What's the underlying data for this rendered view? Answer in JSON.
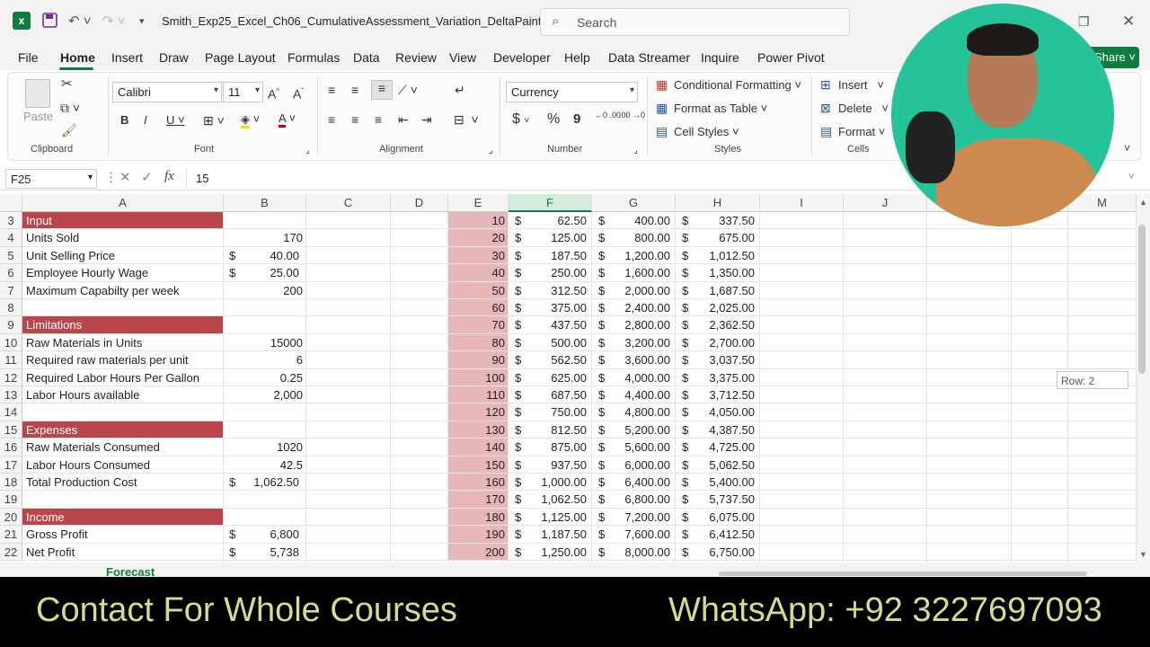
{
  "window": {
    "title": "Smith_Exp25_Excel_Ch06_CumulativeAssessment_Variation_DeltaPaint  -",
    "search_placeholder": "Search"
  },
  "menu": [
    "File",
    "Home",
    "Insert",
    "Draw",
    "Page Layout",
    "Formulas",
    "Data",
    "Review",
    "View",
    "Developer",
    "Help",
    "Data Streamer",
    "Inquire",
    "Power Pivot"
  ],
  "share_label": "Share",
  "ribbon": {
    "clipboard": {
      "paste": "Paste",
      "group": "Clipboard"
    },
    "font": {
      "name": "Calibri",
      "size": "11",
      "bold": "B",
      "italic": "I",
      "underline": "U",
      "grow": "A^",
      "shrink": "Aˇ",
      "color_a": "A",
      "group": "Font"
    },
    "alignment": {
      "group": "Alignment"
    },
    "number": {
      "format": "Currency",
      "dollar": "$",
      "percent": "%",
      "comma": "9",
      "inc": "←0 .00",
      "dec": ".00 →0",
      "group": "Number"
    },
    "styles": {
      "conditional": "Conditional Formatting",
      "table": "Format as Table",
      "cell": "Cell Styles",
      "group": "Styles"
    },
    "cells": {
      "insert": "Insert",
      "delete": "Delete",
      "format": "Format",
      "group": "Cells"
    }
  },
  "formula": {
    "namebox": "F25",
    "fx": "fx",
    "value": "15"
  },
  "columns": [
    "A",
    "B",
    "C",
    "D",
    "E",
    "F",
    "G",
    "H",
    "I",
    "J",
    "K",
    "L",
    "M"
  ],
  "rows": [
    "3",
    "4",
    "5",
    "6",
    "7",
    "8",
    "9",
    "10",
    "11",
    "12",
    "13",
    "14",
    "15",
    "16",
    "17",
    "18",
    "19",
    "20",
    "21",
    "22"
  ],
  "left_table": [
    {
      "a": "Input",
      "b": "",
      "hdr": true
    },
    {
      "a": "Units Sold",
      "b": "170"
    },
    {
      "a": "Unit Selling Price",
      "b_cur": "$",
      "b": "40.00"
    },
    {
      "a": "Employee Hourly Wage",
      "b_cur": "$",
      "b": "25.00"
    },
    {
      "a": "Maximum Capabilty per week",
      "b": "200"
    },
    {
      "a": "",
      "b": ""
    },
    {
      "a": "Limitations",
      "b": "",
      "hdr": true
    },
    {
      "a": "Raw Materials in Units",
      "b": "15000"
    },
    {
      "a": "Required raw materials per unit",
      "b": "6"
    },
    {
      "a": "Required Labor Hours Per Gallon",
      "b": "0.25"
    },
    {
      "a": "Labor Hours available",
      "b": "2,000"
    },
    {
      "a": "",
      "b": ""
    },
    {
      "a": "Expenses",
      "b": "",
      "hdr": true
    },
    {
      "a": "Raw Materials Consumed",
      "b": "1020"
    },
    {
      "a": "Labor Hours Consumed",
      "b": "42.5"
    },
    {
      "a": "Total Production Cost",
      "b_cur": "$",
      "b": "1,062.50"
    },
    {
      "a": "",
      "b": ""
    },
    {
      "a": "Income",
      "b": "",
      "hdr": true
    },
    {
      "a": "Gross Profit",
      "b_cur": "$",
      "b": "6,800"
    },
    {
      "a": "Net Profit",
      "b_cur": "$",
      "b": "5,738"
    }
  ],
  "right_table": [
    {
      "e": "10",
      "f": "62.50",
      "g": "400.00",
      "h": "337.50"
    },
    {
      "e": "20",
      "f": "125.00",
      "g": "800.00",
      "h": "675.00"
    },
    {
      "e": "30",
      "f": "187.50",
      "g": "1,200.00",
      "h": "1,012.50"
    },
    {
      "e": "40",
      "f": "250.00",
      "g": "1,600.00",
      "h": "1,350.00"
    },
    {
      "e": "50",
      "f": "312.50",
      "g": "2,000.00",
      "h": "1,687.50"
    },
    {
      "e": "60",
      "f": "375.00",
      "g": "2,400.00",
      "h": "2,025.00"
    },
    {
      "e": "70",
      "f": "437.50",
      "g": "2,800.00",
      "h": "2,362.50"
    },
    {
      "e": "80",
      "f": "500.00",
      "g": "3,200.00",
      "h": "2,700.00"
    },
    {
      "e": "90",
      "f": "562.50",
      "g": "3,600.00",
      "h": "3,037.50"
    },
    {
      "e": "100",
      "f": "625.00",
      "g": "4,000.00",
      "h": "3,375.00"
    },
    {
      "e": "110",
      "f": "687.50",
      "g": "4,400.00",
      "h": "3,712.50"
    },
    {
      "e": "120",
      "f": "750.00",
      "g": "4,800.00",
      "h": "4,050.00"
    },
    {
      "e": "130",
      "f": "812.50",
      "g": "5,200.00",
      "h": "4,387.50"
    },
    {
      "e": "140",
      "f": "875.00",
      "g": "5,600.00",
      "h": "4,725.00"
    },
    {
      "e": "150",
      "f": "937.50",
      "g": "6,000.00",
      "h": "5,062.50"
    },
    {
      "e": "160",
      "f": "1,000.00",
      "g": "6,400.00",
      "h": "5,400.00"
    },
    {
      "e": "170",
      "f": "1,062.50",
      "g": "6,800.00",
      "h": "5,737.50"
    },
    {
      "e": "180",
      "f": "1,125.00",
      "g": "7,200.00",
      "h": "6,075.00"
    },
    {
      "e": "190",
      "f": "1,187.50",
      "g": "7,600.00",
      "h": "6,412.50"
    },
    {
      "e": "200",
      "f": "1,250.00",
      "g": "8,000.00",
      "h": "6,750.00"
    }
  ],
  "currency_symbol": "$",
  "tooltip": "Row: 2",
  "sheet_tab": "Forecast",
  "banner": {
    "left": "Contact For Whole Courses",
    "right": "WhatsApp:  +92 3227697093"
  },
  "colors": {
    "accent": "#107c41",
    "header_fill": "#b9464b",
    "pink_fill": "#e6b6b8",
    "banner_text": "#d3dd8c"
  }
}
